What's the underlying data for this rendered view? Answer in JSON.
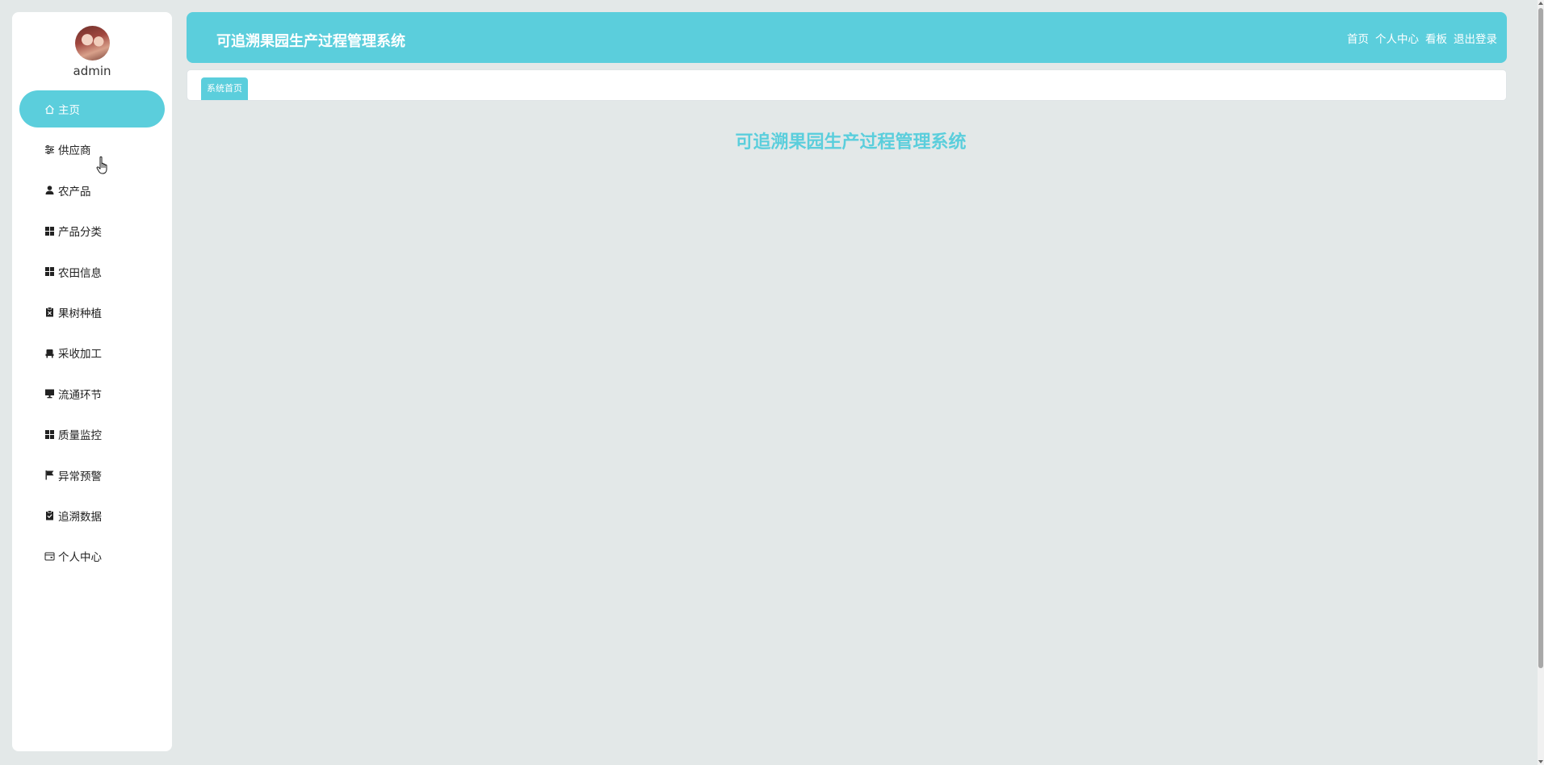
{
  "sidebar": {
    "username": "admin",
    "items": [
      {
        "label": "主页",
        "icon": "home-icon",
        "active": true
      },
      {
        "label": "供应商",
        "icon": "sliders-icon",
        "active": false
      },
      {
        "label": "农产品",
        "icon": "user-icon",
        "active": false
      },
      {
        "label": "产品分类",
        "icon": "grid-icon",
        "active": false
      },
      {
        "label": "农田信息",
        "icon": "grid-icon",
        "active": false
      },
      {
        "label": "果树种植",
        "icon": "clipboard-x-icon",
        "active": false
      },
      {
        "label": "采收加工",
        "icon": "chair-icon",
        "active": false
      },
      {
        "label": "流通环节",
        "icon": "monitor-icon",
        "active": false
      },
      {
        "label": "质量监控",
        "icon": "grid-icon",
        "active": false
      },
      {
        "label": "异常预警",
        "icon": "flag-icon",
        "active": false
      },
      {
        "label": "追溯数据",
        "icon": "clipboard-check-icon",
        "active": false
      },
      {
        "label": "个人中心",
        "icon": "card-icon",
        "active": false
      }
    ]
  },
  "header": {
    "title": "可追溯果园生产过程管理系统",
    "links": [
      {
        "label": "首页"
      },
      {
        "label": "个人中心"
      },
      {
        "label": "看板"
      },
      {
        "label": "退出登录"
      }
    ]
  },
  "tabs": [
    {
      "label": "系统首页",
      "active": true
    }
  ],
  "main": {
    "heading": "可追溯果园生产过程管理系统"
  },
  "colors": {
    "accent": "#5bcedc",
    "background": "#e3e8e8",
    "panel": "#ffffff"
  }
}
